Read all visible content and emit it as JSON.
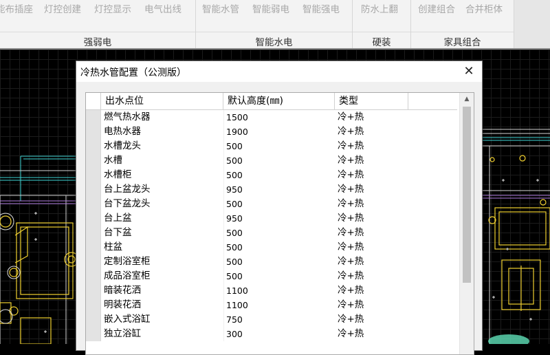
{
  "ribbon": {
    "groups": [
      {
        "label": "强弱电",
        "buttons": [
          "能布插座",
          "灯控创建",
          "灯控显示",
          "电气出线"
        ]
      },
      {
        "label": "智能水电",
        "buttons": [
          "智能水管",
          "智能弱电",
          "智能强电"
        ]
      },
      {
        "label": "硬装",
        "buttons": [
          "防水上翻"
        ]
      },
      {
        "label": "家具组合",
        "buttons": [
          "创建组合",
          "合并柜体"
        ]
      }
    ]
  },
  "dialog": {
    "title": "冷热水管配置（公测版）",
    "close_symbol": "✕",
    "table": {
      "headers": [
        "出水点位",
        "默认高度(㎜)",
        "类型"
      ],
      "rows": [
        {
          "name": "燃气热水器",
          "height": "1500",
          "type": "冷+热"
        },
        {
          "name": "电热水器",
          "height": "1900",
          "type": "冷+热"
        },
        {
          "name": "水槽龙头",
          "height": "500",
          "type": "冷+热"
        },
        {
          "name": "水槽",
          "height": "500",
          "type": "冷+热"
        },
        {
          "name": "水槽柜",
          "height": "500",
          "type": "冷+热"
        },
        {
          "name": "台上盆龙头",
          "height": "950",
          "type": "冷+热"
        },
        {
          "name": "台下盆龙头",
          "height": "500",
          "type": "冷+热"
        },
        {
          "name": "台上盆",
          "height": "950",
          "type": "冷+热"
        },
        {
          "name": "台下盆",
          "height": "500",
          "type": "冷+热"
        },
        {
          "name": "柱盆",
          "height": "500",
          "type": "冷+热"
        },
        {
          "name": "定制浴室柜",
          "height": "500",
          "type": "冷+热"
        },
        {
          "name": "成品浴室柜",
          "height": "500",
          "type": "冷+热"
        },
        {
          "name": "暗装花洒",
          "height": "1100",
          "type": "冷+热"
        },
        {
          "name": "明装花洒",
          "height": "1100",
          "type": "冷+热"
        },
        {
          "name": "嵌入式浴缸",
          "height": "750",
          "type": "冷+热"
        },
        {
          "name": "独立浴缸",
          "height": "300",
          "type": "冷+热"
        }
      ]
    }
  }
}
